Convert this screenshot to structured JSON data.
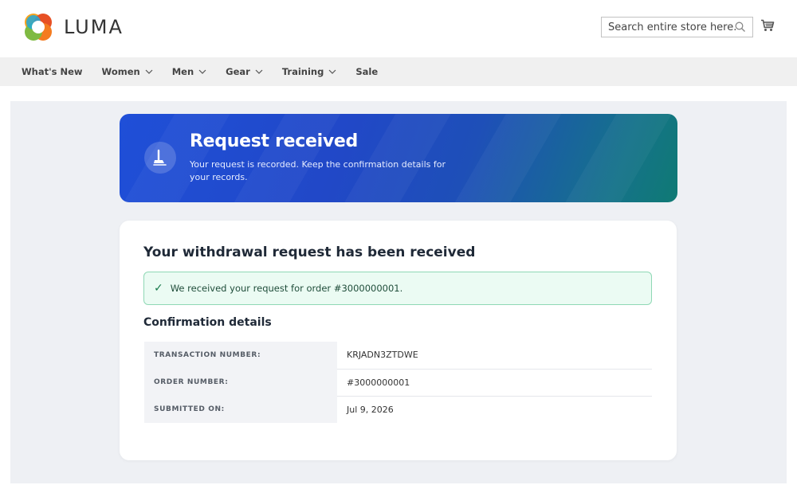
{
  "header": {
    "logo_text": "LUMA",
    "search": {
      "placeholder": "Search entire store here...",
      "value": ""
    },
    "icons": {
      "search": "search-icon",
      "cart": "cart-icon"
    }
  },
  "nav": {
    "items": [
      {
        "label": "What's New",
        "has_dropdown": false
      },
      {
        "label": "Women",
        "has_dropdown": true
      },
      {
        "label": "Men",
        "has_dropdown": true
      },
      {
        "label": "Gear",
        "has_dropdown": true
      },
      {
        "label": "Training",
        "has_dropdown": true
      },
      {
        "label": "Sale",
        "has_dropdown": false
      }
    ]
  },
  "banner": {
    "title": "Request received",
    "description": "Your request is recorded. Keep the confirmation details for your records.",
    "icon": "broom-icon"
  },
  "card": {
    "title": "Your withdrawal request has been received",
    "alert": {
      "icon": "checkmark",
      "text": "We received your request for order #3000000001."
    },
    "section_title": "Confirmation details",
    "rows": [
      {
        "label": "TRANSACTION NUMBER:",
        "value": "KRJADN3ZTDWE"
      },
      {
        "label": "ORDER NUMBER:",
        "value": "#3000000001"
      },
      {
        "label": "SUBMITTED ON:",
        "value": "Jul 9, 2026"
      }
    ]
  },
  "colors": {
    "banner_start": "#1f4fd8",
    "banner_end": "#0f7a74",
    "success_bg": "#ebfbf3",
    "success_border": "#8fd8b5",
    "nav_bg": "#f0f0f0",
    "page_bg": "#eef0f4"
  }
}
